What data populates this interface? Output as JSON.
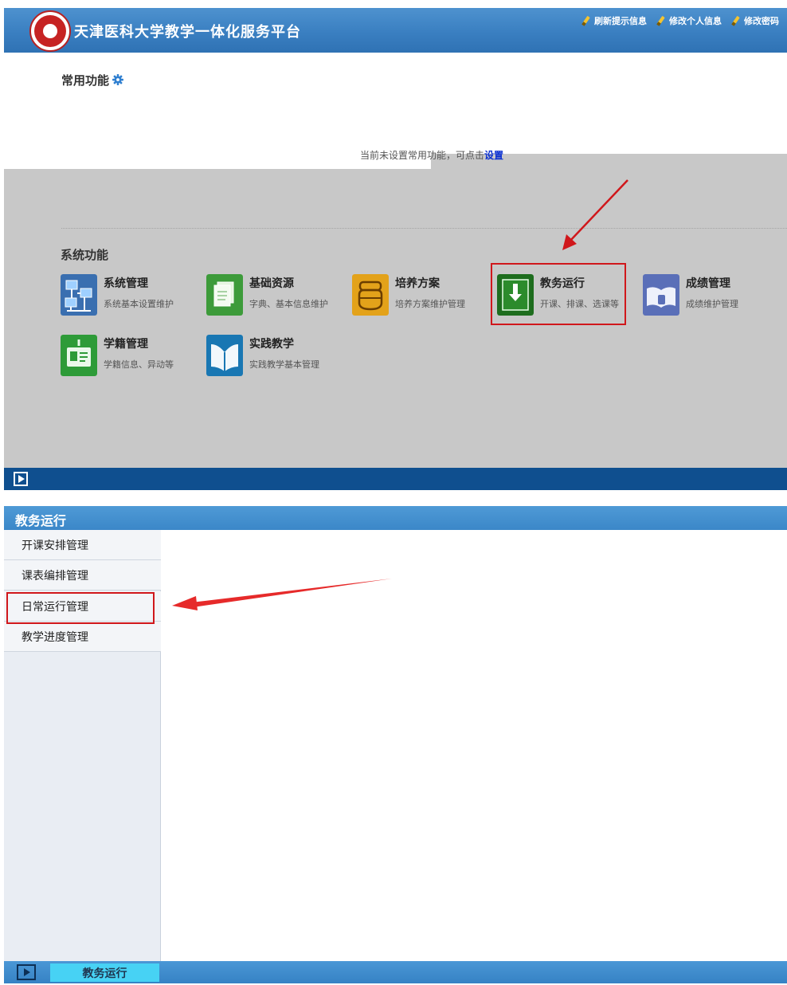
{
  "header": {
    "site_title": "天津医科大学教学一体化服务平台",
    "links": [
      "刷新提示信息",
      "修改个人信息",
      "修改密码"
    ]
  },
  "common": {
    "title": "常用功能",
    "hint_text": "当前未设置常用功能，可点击",
    "hint_link": "设置"
  },
  "system": {
    "title": "系统功能",
    "tiles": [
      {
        "name": "系统管理",
        "desc": "系统基本设置维护",
        "icon": "network-icon",
        "color": "#3a6fb0"
      },
      {
        "name": "基础资源",
        "desc": "字典、基本信息维护",
        "icon": "documents-icon",
        "color": "#3d9b3a"
      },
      {
        "name": "培养方案",
        "desc": "培养方案维护管理",
        "icon": "pot-icon",
        "color": "#e3a21a"
      },
      {
        "name": "教务运行",
        "desc": "开课、排课、选课等",
        "icon": "download-icon",
        "color": "#1e6d1e"
      },
      {
        "name": "成绩管理",
        "desc": "成绩维护管理",
        "icon": "book-hand-icon",
        "color": "#5a6fb8"
      },
      {
        "name": "学籍管理",
        "desc": "学籍信息、异动等",
        "icon": "id-card-icon",
        "color": "#2e9b38"
      },
      {
        "name": "实践教学",
        "desc": "实践教学基本管理",
        "icon": "open-book-icon",
        "color": "#1977b3"
      }
    ]
  },
  "panel": {
    "title": "教务运行",
    "menu": [
      "开课安排管理",
      "课表编排管理",
      "日常运行管理",
      "教学进度管理"
    ]
  },
  "taskbar": {
    "active_tab": "教务运行"
  }
}
